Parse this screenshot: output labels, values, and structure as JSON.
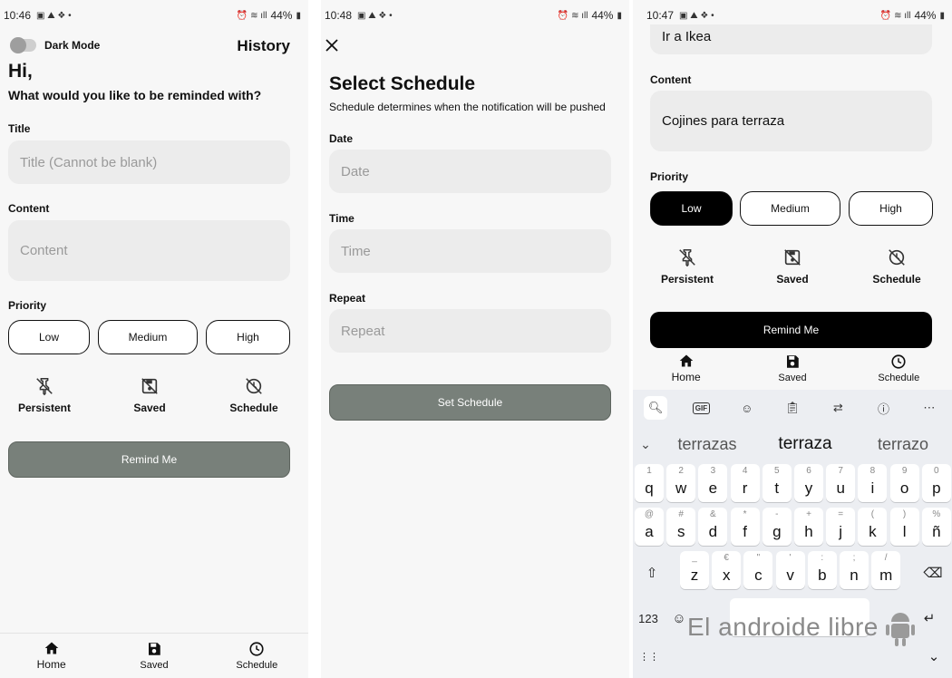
{
  "screen1": {
    "status": {
      "time": "10:46",
      "battery": "44%"
    },
    "dark_mode_label": "Dark Mode",
    "history_label": "History",
    "greeting": "Hi,",
    "prompt": "What would you like to be reminded with?",
    "title_label": "Title",
    "title_placeholder": "Title (Cannot be blank)",
    "content_label": "Content",
    "content_placeholder": "Content",
    "priority_label": "Priority",
    "priority": [
      "Low",
      "Medium",
      "High"
    ],
    "options": [
      "Persistent",
      "Saved",
      "Schedule"
    ],
    "remind_label": "Remind Me",
    "nav": [
      "Home",
      "Saved",
      "Schedule"
    ]
  },
  "screen2": {
    "status": {
      "time": "10:48",
      "battery": "44%"
    },
    "heading": "Select Schedule",
    "subheading": "Schedule determines when the notification will be pushed",
    "date_label": "Date",
    "date_placeholder": "Date",
    "time_label": "Time",
    "time_placeholder": "Time",
    "repeat_label": "Repeat",
    "repeat_placeholder": "Repeat",
    "set_label": "Set Schedule"
  },
  "screen3": {
    "status": {
      "time": "10:47",
      "battery": "44%"
    },
    "title_value": "Ir a Ikea",
    "content_label": "Content",
    "content_value": "Cojines para terraza",
    "priority_label": "Priority",
    "priority": [
      "Low",
      "Medium",
      "High"
    ],
    "selected_priority": "Low",
    "options": [
      "Persistent",
      "Saved",
      "Schedule"
    ],
    "remind_label": "Remind Me",
    "nav": [
      "Home",
      "Saved",
      "Schedule"
    ],
    "keyboard": {
      "gif_label": "GIF",
      "suggestions": [
        "terrazas",
        "terraza",
        "terrazo"
      ],
      "row1": [
        [
          "1",
          "q"
        ],
        [
          "2",
          "w"
        ],
        [
          "3",
          "e"
        ],
        [
          "4",
          "r"
        ],
        [
          "5",
          "t"
        ],
        [
          "6",
          "y"
        ],
        [
          "7",
          "u"
        ],
        [
          "8",
          "i"
        ],
        [
          "9",
          "o"
        ],
        [
          "0",
          "p"
        ]
      ],
      "row2": [
        [
          "@",
          "a"
        ],
        [
          "#",
          "s"
        ],
        [
          "&",
          "d"
        ],
        [
          "*",
          "f"
        ],
        [
          "-",
          "g"
        ],
        [
          "+",
          "h"
        ],
        [
          "=",
          "j"
        ],
        [
          "(",
          "k"
        ],
        [
          ")",
          "l"
        ],
        [
          "%",
          "ñ"
        ]
      ],
      "row3": [
        [
          "_",
          "z"
        ],
        [
          "€",
          "x"
        ],
        [
          "\"",
          "c"
        ],
        [
          "'",
          "v"
        ],
        [
          ":",
          "b"
        ],
        [
          ";",
          "n"
        ],
        [
          "/",
          "m"
        ]
      ],
      "numbers_key": "123"
    },
    "watermark": "El androide libre"
  }
}
